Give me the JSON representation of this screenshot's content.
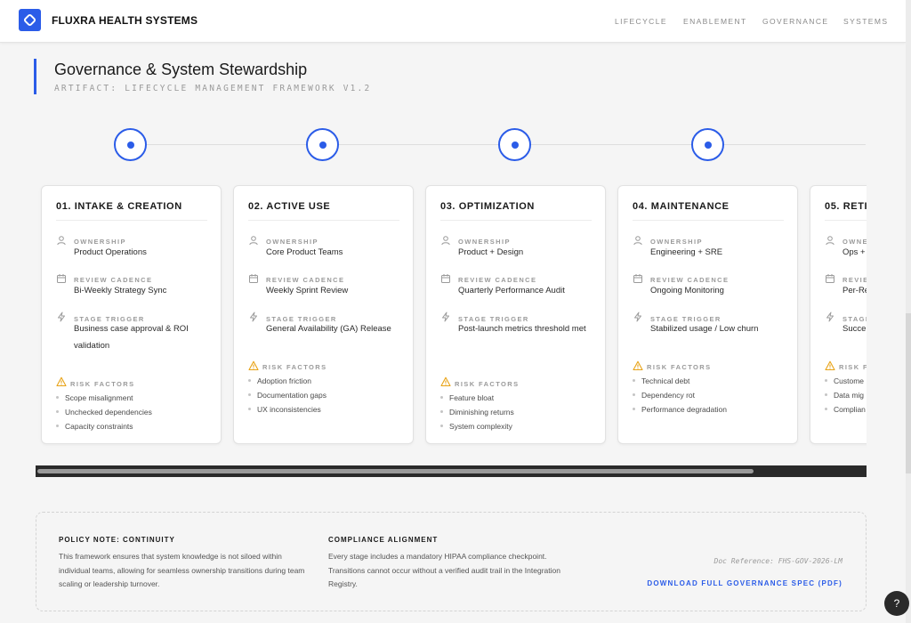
{
  "header": {
    "brand": "FLUXRA HEALTH SYSTEMS",
    "nav": [
      "LIFECYCLE",
      "ENABLEMENT",
      "GOVERNANCE",
      "SYSTEMS"
    ]
  },
  "page": {
    "title": "Governance & System Stewardship",
    "artifact": "ARTIFACT: LIFECYCLE MANAGEMENT FRAMEWORK V1.2"
  },
  "labels": {
    "ownership": "OWNERSHIP",
    "review": "REVIEW CADENCE",
    "trigger": "STAGE TRIGGER",
    "risk": "RISK FACTORS"
  },
  "stages": [
    {
      "title": "01. INTAKE & CREATION",
      "ownership": "Product Operations",
      "review": "Bi-Weekly Strategy Sync",
      "trigger": "Business case approval & ROI validation",
      "risks": [
        "Scope misalignment",
        "Unchecked dependencies",
        "Capacity constraints"
      ]
    },
    {
      "title": "02. ACTIVE USE",
      "ownership": "Core Product Teams",
      "review": "Weekly Sprint Review",
      "trigger": "General Availability (GA) Release",
      "risks": [
        "Adoption friction",
        "Documentation gaps",
        "UX inconsistencies"
      ]
    },
    {
      "title": "03. OPTIMIZATION",
      "ownership": "Product + Design",
      "review": "Quarterly Performance Audit",
      "trigger": "Post-launch metrics threshold met",
      "risks": [
        "Feature bloat",
        "Diminishing returns",
        "System complexity"
      ]
    },
    {
      "title": "04. MAINTENANCE",
      "ownership": "Engineering + SRE",
      "review": "Ongoing Monitoring",
      "trigger": "Stabilized usage / Low churn",
      "risks": [
        "Technical debt",
        "Dependency rot",
        "Performance degradation"
      ]
    },
    {
      "title": "05. RETI",
      "ownership": "Ops +",
      "review": "Per-Re",
      "trigger": "Succe",
      "risks": [
        "Custome",
        "Data mig",
        "Complian"
      ]
    }
  ],
  "footer": {
    "policy_heading": "POLICY NOTE: CONTINUITY",
    "policy_text": "This framework ensures that system knowledge is not siloed within individual teams, allowing for seamless ownership transitions during team scaling or leadership turnover.",
    "compliance_heading": "COMPLIANCE ALIGNMENT",
    "compliance_text": "Every stage includes a mandatory HIPAA compliance checkpoint. Transitions cannot occur without a verified audit trail in the Integration Registry.",
    "doc_ref": "Doc Reference: FHS-GOV-2026-LM",
    "download": "DOWNLOAD FULL GOVERNANCE SPEC (PDF)"
  },
  "help": "?",
  "colors": {
    "accent": "#2b5ce8",
    "warning": "#e8a317"
  },
  "icons": {
    "ownership": "user-icon",
    "review": "calendar-icon",
    "trigger": "bolt-icon",
    "risk": "warning-icon"
  }
}
